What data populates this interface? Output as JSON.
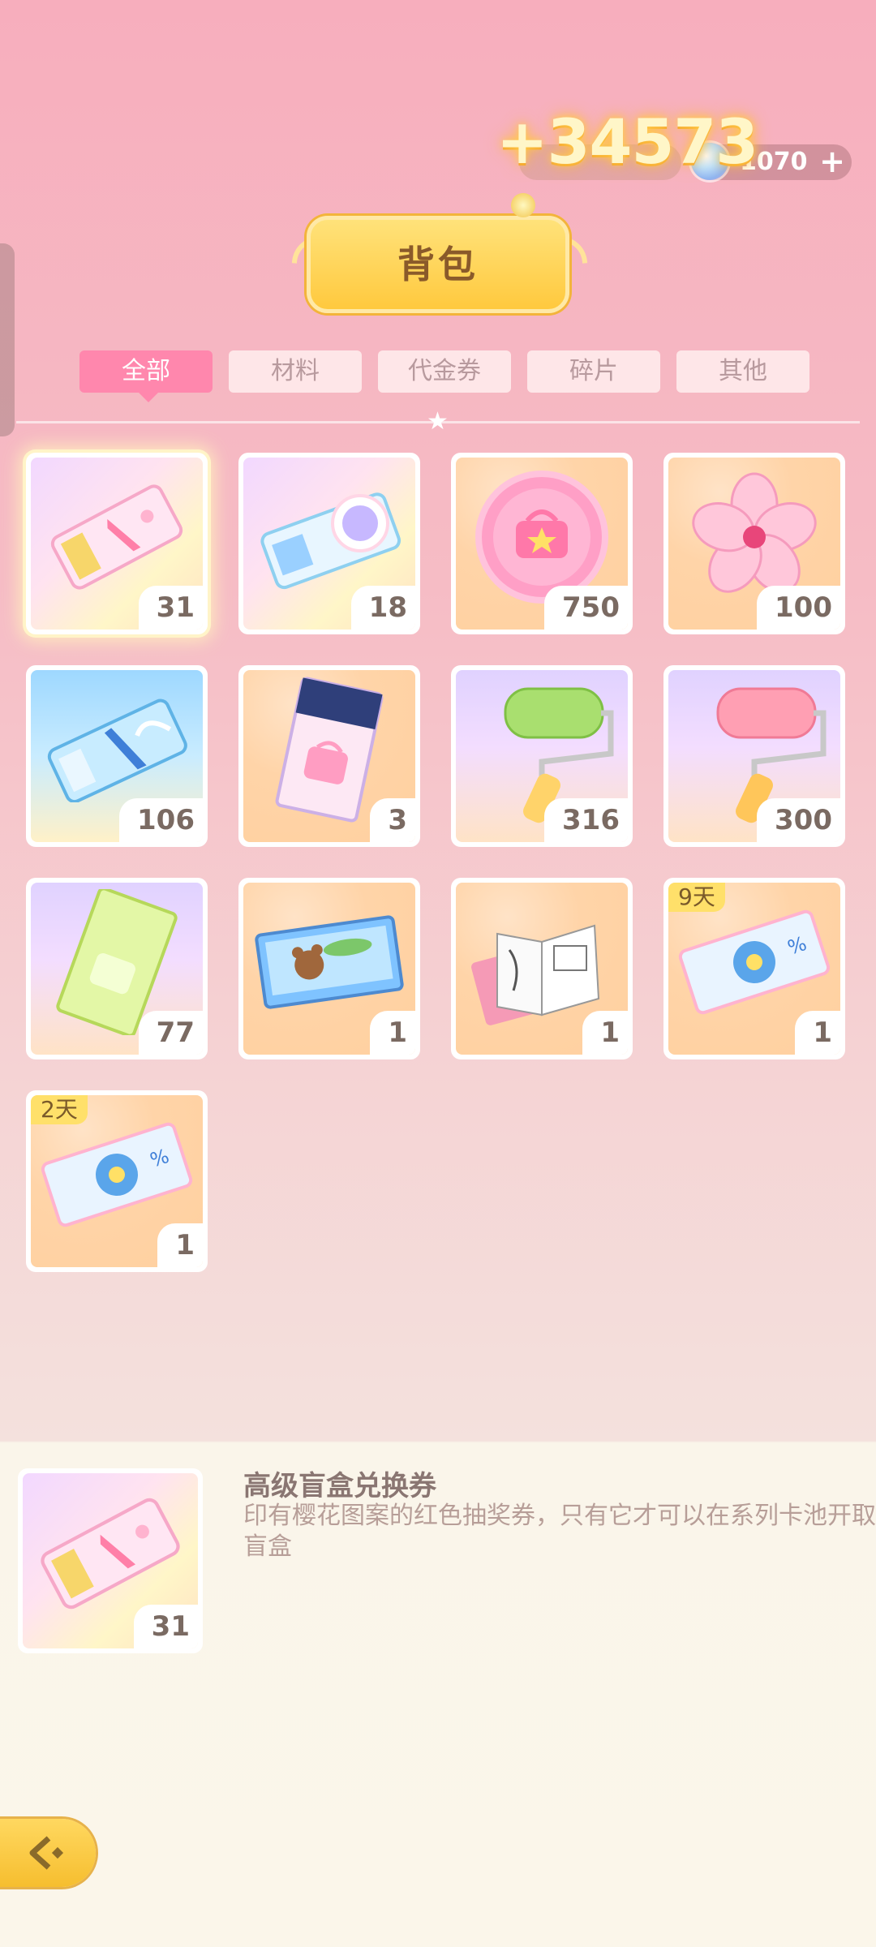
{
  "header": {
    "gain_text": "+34573",
    "gem_amount": "1070",
    "gem_plus": "+",
    "title": "背包"
  },
  "tabs": [
    {
      "label": "全部",
      "active": true
    },
    {
      "label": "材料",
      "active": false
    },
    {
      "label": "代金券",
      "active": false
    },
    {
      "label": "碎片",
      "active": false
    },
    {
      "label": "其他",
      "active": false
    }
  ],
  "items": [
    {
      "icon": "premium-ticket-icon",
      "count": "31",
      "badge": ""
    },
    {
      "icon": "avatar-ticket-icon",
      "count": "18",
      "badge": ""
    },
    {
      "icon": "pink-bag-coin-icon",
      "count": "750",
      "badge": ""
    },
    {
      "icon": "sakura-flower-icon",
      "count": "100",
      "badge": ""
    },
    {
      "icon": "blue-ticket-icon",
      "count": "106",
      "badge": ""
    },
    {
      "icon": "blind-box-ticket-icon",
      "count": "3",
      "badge": ""
    },
    {
      "icon": "green-paint-roller-icon",
      "count": "316",
      "badge": ""
    },
    {
      "icon": "pink-paint-roller-icon",
      "count": "300",
      "badge": ""
    },
    {
      "icon": "green-ticket-icon",
      "count": "77",
      "badge": ""
    },
    {
      "icon": "bear-puzzle-box-icon",
      "count": "1",
      "badge": ""
    },
    {
      "icon": "sketchbook-icon",
      "count": "1",
      "badge": ""
    },
    {
      "icon": "sale-coupon-icon",
      "count": "1",
      "badge": "9天"
    },
    {
      "icon": "sale-coupon-icon",
      "count": "1",
      "badge": "2天"
    }
  ],
  "detail": {
    "icon": "premium-ticket-icon",
    "count": "31",
    "name": "高级盲盒兑换券",
    "description": "印有樱花图案的红色抽奖券，只有它才可以在系列卡池开取盲盒"
  },
  "colors": {
    "tab_active": "#ff87ad",
    "badge": "#ffe06a",
    "title_button": "#ffc93e"
  }
}
